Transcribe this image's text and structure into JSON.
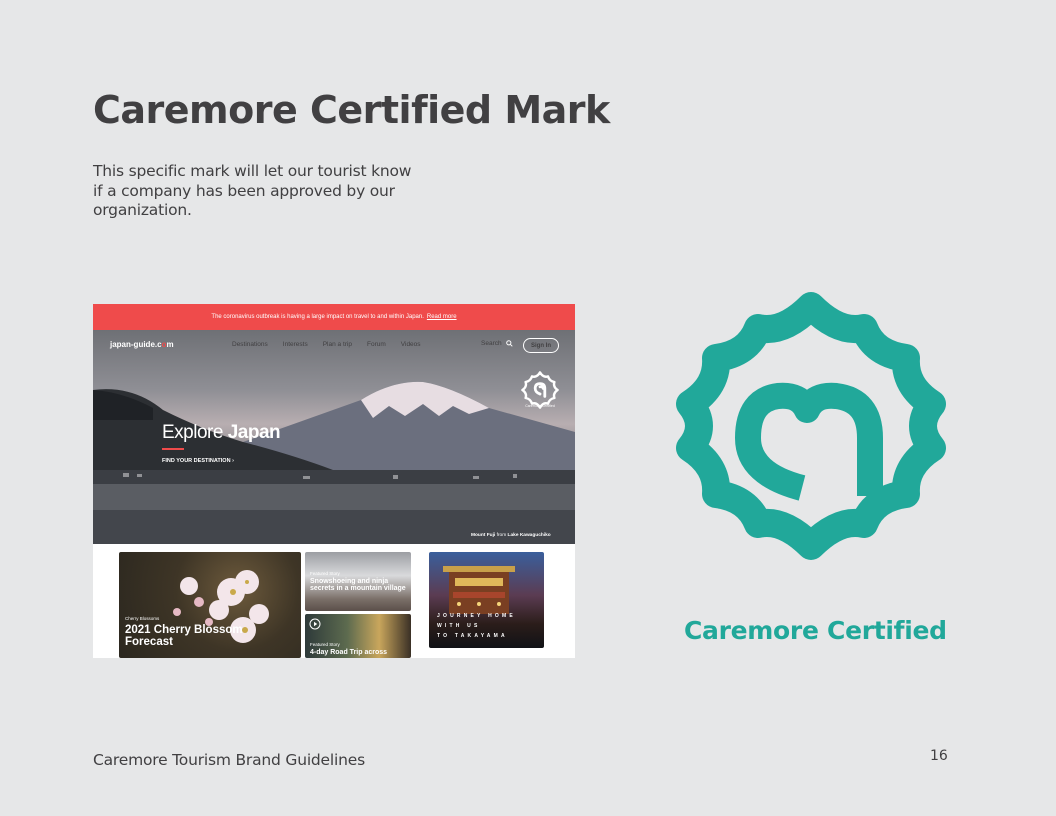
{
  "page": {
    "title": "Caremore Certified Mark",
    "intro": "This specific mark will let our tourist know if a company has been approved by our organization.",
    "footer": "Caremore Tourism Brand Guidelines",
    "page_number": "16"
  },
  "screenshot": {
    "alert_text": "The coronavirus outbreak is having a large impact on travel to and within Japan.",
    "alert_link": "Read more",
    "logo_prefix": "japan-guide.c",
    "logo_dot": "o",
    "logo_suffix": "m",
    "nav_items": [
      "Destinations",
      "Interests",
      "Plan a trip",
      "Forum",
      "Videos"
    ],
    "search_label": "Search",
    "signin_label": "Sign In",
    "badge_caption": "Caremore Certified",
    "hero_title_light": "Explore",
    "hero_title_bold": "Japan",
    "hero_cta": "FIND YOUR DESTINATION",
    "hero_credit_pre": "Mount Fuji",
    "hero_credit_mid": "from",
    "hero_credit_post": "Lake Kawaguchiko",
    "cards": [
      {
        "tag": "Cherry Blossoms",
        "title": "2021 Cherry Blossom Forecast"
      },
      {
        "tag": "Featured Story",
        "title": "Snowshoeing and ninja secrets in a mountain village"
      },
      {
        "tag": "Featured Story",
        "title": "4-day Road Trip across"
      }
    ],
    "journey_lines": [
      "JOURNEY HOME",
      "WITH US",
      "TO TAKAYAMA"
    ]
  },
  "mark": {
    "label": "Caremore Certified",
    "color": "#21a89a"
  },
  "colors": {
    "background": "#e6e7e8",
    "text": "#414042",
    "alert_red": "#ef4b4b",
    "brand_teal": "#21a89a"
  }
}
